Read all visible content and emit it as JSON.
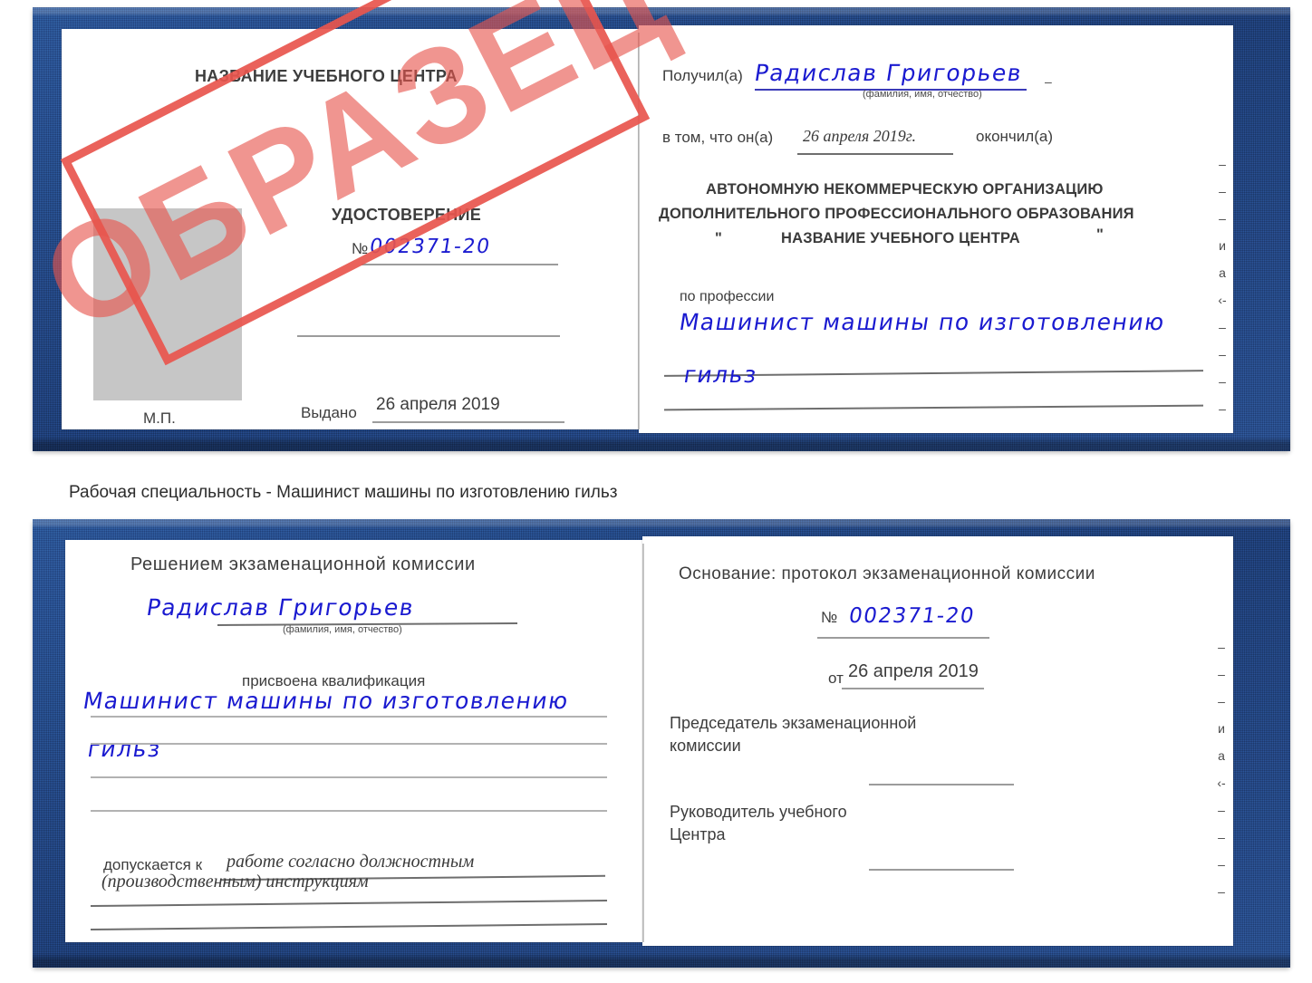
{
  "page": {
    "background_color": "#ffffff",
    "cover_color": "#234a8a",
    "paper_color": "#ffffff",
    "ink_color": "#1a1ad0",
    "stamp_color": "#e8554d",
    "rule_color": "#9c9c9c"
  },
  "caption": {
    "text": "Рабочая специальность - Машинист машины по изготовлению гильз"
  },
  "stamp": {
    "label": "ОБРАЗЕЦ"
  },
  "certificate_top": {
    "left_page": {
      "center_name": "НАЗВАНИЕ УЧЕБНОГО ЦЕНТРА",
      "doc_type": "УДОСТОВЕРЕНИЕ",
      "number_prefix": "№",
      "number_value": "002371-20",
      "issued_label": "Выдано",
      "issued_date": "26 апреля 2019",
      "seal_label": "М.П.",
      "photo_placeholder": "photo-placeholder"
    },
    "right_page": {
      "received_label": "Получил(а)",
      "received_name": "Радислав Григорьев",
      "name_hint": "(фамилия, имя, отчество)",
      "that_he_label": "в том, что он(а)",
      "graduation_date": "26 апреля 2019г.",
      "graduated_label": "окончил(а)",
      "org_line1": "АВТОНОМНУЮ НЕКОММЕРЧЕСКУЮ ОРГАНИЗАЦИЮ",
      "org_line2": "ДОПОЛНИТЕЛЬНОГО ПРОФЕССИОНАЛЬНОГО ОБРАЗОВАНИЯ",
      "org_quote_open": "\"",
      "org_line3": "НАЗВАНИЕ УЧЕБНОГО ЦЕНТРА",
      "org_quote_close": "\"",
      "profession_label": "по профессии",
      "profession_line1": "Машинист машины по изготовлению",
      "profession_line2": "гильз",
      "edge_fragments": [
        "–",
        "–",
        "–",
        "и",
        "а",
        "‹-",
        "–",
        "–",
        "–",
        "–"
      ]
    }
  },
  "certificate_bottom": {
    "left_page": {
      "decision_title": "Решением экзаменационной комиссии",
      "name_value": "Радислав Григорьев",
      "name_hint": "(фамилия, имя, отчество)",
      "qualification_label": "присвоена квалификация",
      "qualification_line1": "Машинист машины по изготовлению",
      "qualification_line2": "гильз",
      "admitted_label": "допускается к",
      "admitted_text_line1": "работе согласно должностным",
      "admitted_text_line2": "(производственным) инструкциям"
    },
    "right_page": {
      "basis_label": "Основание: протокол экзаменационной комиссии",
      "protocol_number_prefix": "№",
      "protocol_number_value": "002371-20",
      "protocol_date_prefix": "от",
      "protocol_date_value": "26 апреля 2019",
      "chairman_line1": "Председатель экзаменационной",
      "chairman_line2": "комиссии",
      "head_line1": "Руководитель учебного",
      "head_line2": "Центра",
      "edge_fragments": [
        "–",
        "–",
        "–",
        "и",
        "а",
        "‹-",
        "–",
        "–",
        "–",
        "–"
      ]
    }
  }
}
